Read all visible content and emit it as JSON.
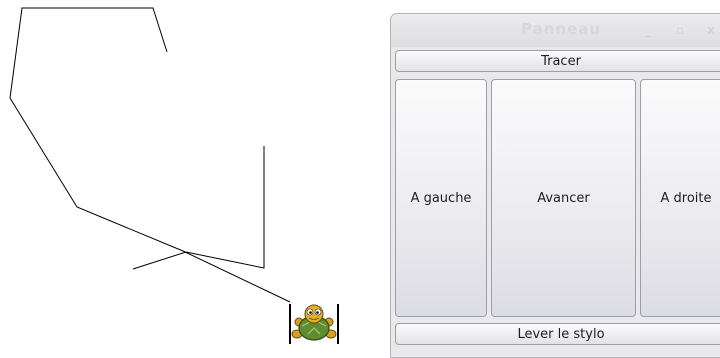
{
  "window": {
    "title": "Panneau",
    "controls": {
      "minimize": "_",
      "maximize": "▫",
      "close": "x"
    }
  },
  "buttons": {
    "draw": "Tracer",
    "left": "A gauche",
    "forward": "Avancer",
    "right": "A droite",
    "pen_up": "Lever le stylo"
  },
  "drawing": {
    "line_color": "#000000",
    "turtle_icon": "turtle-icon"
  }
}
